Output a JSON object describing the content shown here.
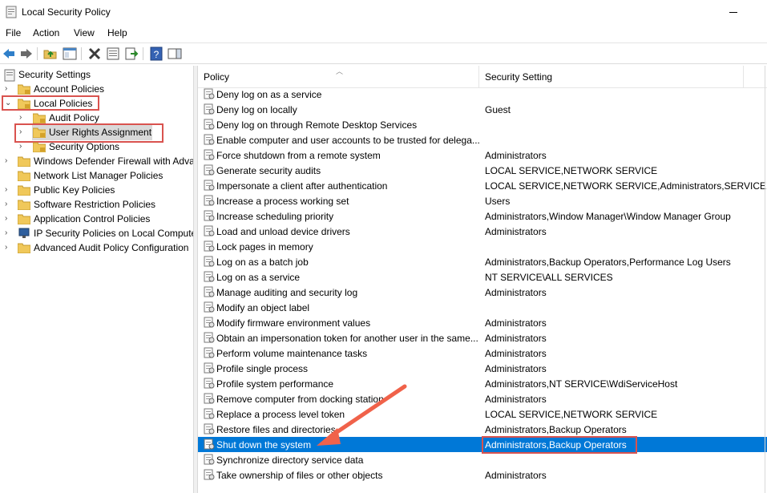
{
  "window": {
    "title": "Local Security Policy"
  },
  "menu": {
    "items": [
      "File",
      "Action",
      "View",
      "Help"
    ]
  },
  "toolbar": {
    "buttons": [
      "back-icon",
      "forward-icon",
      "up-folder-icon",
      "show-hide-tree-icon",
      "delete-icon",
      "properties-icon",
      "export-list-icon",
      "help-icon",
      "show-action-pane-icon"
    ]
  },
  "tree": {
    "root": "Security Settings",
    "items": [
      {
        "label": "Account Policies",
        "level": 1,
        "expanded": false
      },
      {
        "label": "Local Policies",
        "level": 1,
        "expanded": true
      },
      {
        "label": "Audit Policy",
        "level": 2,
        "expanded": false
      },
      {
        "label": "User Rights Assignment",
        "level": 2,
        "expanded": false,
        "selected": true
      },
      {
        "label": "Security Options",
        "level": 2,
        "expanded": false
      },
      {
        "label": "Windows Defender Firewall with Adva",
        "level": 1,
        "expanded": false
      },
      {
        "label": "Network List Manager Policies",
        "level": 1,
        "expanded": false
      },
      {
        "label": "Public Key Policies",
        "level": 1,
        "expanded": false
      },
      {
        "label": "Software Restriction Policies",
        "level": 1,
        "expanded": false
      },
      {
        "label": "Application Control Policies",
        "level": 1,
        "expanded": false
      },
      {
        "label": "IP Security Policies on Local Compute",
        "level": 1,
        "expanded": false
      },
      {
        "label": "Advanced Audit Policy Configuration",
        "level": 1,
        "expanded": false
      }
    ]
  },
  "list": {
    "columns": {
      "policy": "Policy",
      "setting": "Security Setting"
    },
    "rows": [
      {
        "policy": "Deny log on as a service",
        "setting": ""
      },
      {
        "policy": "Deny log on locally",
        "setting": "Guest"
      },
      {
        "policy": "Deny log on through Remote Desktop Services",
        "setting": ""
      },
      {
        "policy": "Enable computer and user accounts to be trusted for delega...",
        "setting": ""
      },
      {
        "policy": "Force shutdown from a remote system",
        "setting": "Administrators"
      },
      {
        "policy": "Generate security audits",
        "setting": "LOCAL SERVICE,NETWORK SERVICE"
      },
      {
        "policy": "Impersonate a client after authentication",
        "setting": "LOCAL SERVICE,NETWORK SERVICE,Administrators,SERVICE"
      },
      {
        "policy": "Increase a process working set",
        "setting": "Users"
      },
      {
        "policy": "Increase scheduling priority",
        "setting": "Administrators,Window Manager\\Window Manager Group"
      },
      {
        "policy": "Load and unload device drivers",
        "setting": "Administrators"
      },
      {
        "policy": "Lock pages in memory",
        "setting": ""
      },
      {
        "policy": "Log on as a batch job",
        "setting": "Administrators,Backup Operators,Performance Log Users"
      },
      {
        "policy": "Log on as a service",
        "setting": "NT SERVICE\\ALL SERVICES"
      },
      {
        "policy": "Manage auditing and security log",
        "setting": "Administrators"
      },
      {
        "policy": "Modify an object label",
        "setting": ""
      },
      {
        "policy": "Modify firmware environment values",
        "setting": "Administrators"
      },
      {
        "policy": "Obtain an impersonation token for another user in the same...",
        "setting": "Administrators"
      },
      {
        "policy": "Perform volume maintenance tasks",
        "setting": "Administrators"
      },
      {
        "policy": "Profile single process",
        "setting": "Administrators"
      },
      {
        "policy": "Profile system performance",
        "setting": "Administrators,NT SERVICE\\WdiServiceHost"
      },
      {
        "policy": "Remove computer from docking station",
        "setting": "Administrators"
      },
      {
        "policy": "Replace a process level token",
        "setting": "LOCAL SERVICE,NETWORK SERVICE"
      },
      {
        "policy": "Restore files and directories",
        "setting": "Administrators,Backup Operators"
      },
      {
        "policy": "Shut down the system",
        "setting": "Administrators,Backup Operators",
        "selected": true
      },
      {
        "policy": "Synchronize directory service data",
        "setting": ""
      },
      {
        "policy": "Take ownership of files or other objects",
        "setting": "Administrators"
      }
    ]
  },
  "colors": {
    "selection": "#0078d7",
    "annotation": "#d9534f",
    "arrow": "#f0624a"
  }
}
